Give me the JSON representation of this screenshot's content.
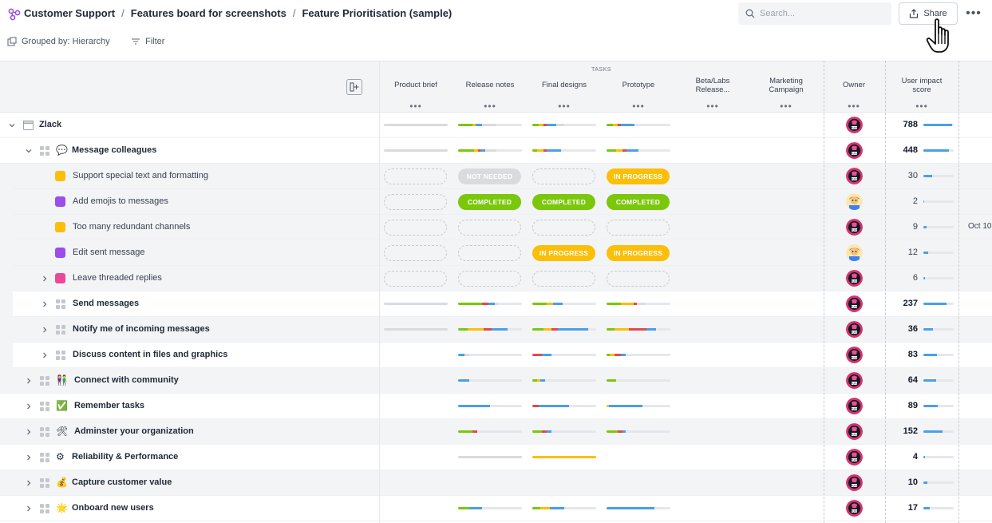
{
  "breadcrumb": [
    "Customer Support",
    "Features board for screenshots",
    "Feature Prioritisation (sample)"
  ],
  "breadcrumb_sep": "/",
  "search": {
    "placeholder": "Search..."
  },
  "share_label": "Share",
  "more_label": "•••",
  "toolbar": {
    "grouped_label": "Grouped by: Hierarchy",
    "filter_label": "Filter"
  },
  "colors": {
    "green": "#7ac70c",
    "yellow": "#fbbf0a",
    "blue": "#4a9fe8",
    "red": "#e5484d",
    "gray": "#d9dbde",
    "purple": "#9b4ee8",
    "pink": "#ec4899"
  },
  "columns": {
    "tasks_group": "TASKS",
    "product_brief": "Product brief",
    "release_notes": "Release notes",
    "final_designs": "Final designs",
    "prototype": "Prototype",
    "beta_labs": "Beta/Labs Release...",
    "marketing": "Marketing Campaign",
    "owner": "Owner",
    "impact": "User impact score",
    "dots": "•••"
  },
  "statuses": {
    "completed": "COMPLETED",
    "in_progress": "IN PROGRESS",
    "not_needed": "NOT NEEDED"
  },
  "rows": [
    {
      "name": "Zlack",
      "score": "788",
      "impact": 0.95
    },
    {
      "name": "Message colleagues",
      "emoji": "💬",
      "score": "448",
      "impact": 0.85
    },
    {
      "name": "Support special text and formatting",
      "score": "30",
      "impact": 0.3
    },
    {
      "name": "Add emojis to messages",
      "score": "2",
      "impact": 0.02
    },
    {
      "name": "Too many redundant channels",
      "score": "9",
      "impact": 0.1,
      "date": "Oct 10,"
    },
    {
      "name": "Edit sent message",
      "score": "12",
      "impact": 0.15
    },
    {
      "name": "Leave threaded replies",
      "score": "6",
      "impact": 0.06
    },
    {
      "name": "Send messages",
      "score": "237",
      "impact": 0.75
    },
    {
      "name": "Notify me of incoming messages",
      "score": "36",
      "impact": 0.32
    },
    {
      "name": "Discuss content in files and graphics",
      "score": "83",
      "impact": 0.45
    },
    {
      "name": "Connect with community",
      "emoji": "👫",
      "score": "64",
      "impact": 0.42
    },
    {
      "name": "Remember tasks",
      "emoji": "✅",
      "score": "89",
      "impact": 0.48
    },
    {
      "name": "Adminster your organization",
      "emoji": "🛠",
      "score": "152",
      "impact": 0.62
    },
    {
      "name": "Reliability & Performance",
      "emoji": "⚙",
      "score": "4",
      "impact": 0.04
    },
    {
      "name": "Capture customer value",
      "emoji": "💰",
      "score": "10",
      "impact": 0.12
    },
    {
      "name": "Onboard new users",
      "emoji": "🌟",
      "score": "17",
      "impact": 0.2
    }
  ]
}
